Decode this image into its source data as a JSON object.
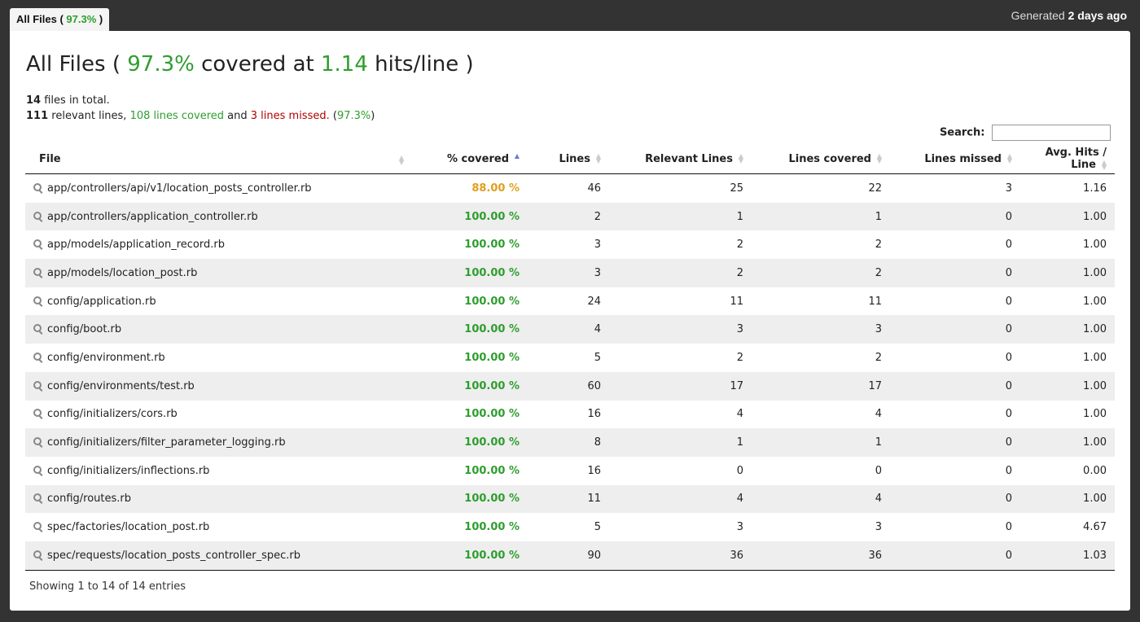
{
  "tab": {
    "label": "All Files (",
    "percent": "97.3%",
    "close": ")"
  },
  "generated": {
    "prefix": "Generated",
    "when": "2 days ago"
  },
  "heading": {
    "prefix": "All Files (",
    "percent": "97.3%",
    "middle": "covered at",
    "hits": "1.14",
    "suffix": "hits/line )"
  },
  "summary": {
    "files_count": "14",
    "files_text": "files in total.",
    "relevant": "111",
    "relevant_text": "relevant lines,",
    "covered_text": "108 lines covered",
    "and_text": "and",
    "missed_text": "3 lines missed.",
    "pct_open": "(",
    "pct": "97.3%",
    "pct_close": ")"
  },
  "search": {
    "label": "Search:",
    "value": ""
  },
  "table": {
    "headers": [
      "File",
      "% covered",
      "Lines",
      "Relevant Lines",
      "Lines covered",
      "Lines missed",
      "Avg. Hits / Line"
    ],
    "rows": [
      {
        "file": "app/controllers/api/v1/location_posts_controller.rb",
        "pct": "88.00 %",
        "lines": "46",
        "relevant": "25",
        "covered": "22",
        "missed": "3",
        "avg": "1.16"
      },
      {
        "file": "app/controllers/application_controller.rb",
        "pct": "100.00 %",
        "lines": "2",
        "relevant": "1",
        "covered": "1",
        "missed": "0",
        "avg": "1.00"
      },
      {
        "file": "app/models/application_record.rb",
        "pct": "100.00 %",
        "lines": "3",
        "relevant": "2",
        "covered": "2",
        "missed": "0",
        "avg": "1.00"
      },
      {
        "file": "app/models/location_post.rb",
        "pct": "100.00 %",
        "lines": "3",
        "relevant": "2",
        "covered": "2",
        "missed": "0",
        "avg": "1.00"
      },
      {
        "file": "config/application.rb",
        "pct": "100.00 %",
        "lines": "24",
        "relevant": "11",
        "covered": "11",
        "missed": "0",
        "avg": "1.00"
      },
      {
        "file": "config/boot.rb",
        "pct": "100.00 %",
        "lines": "4",
        "relevant": "3",
        "covered": "3",
        "missed": "0",
        "avg": "1.00"
      },
      {
        "file": "config/environment.rb",
        "pct": "100.00 %",
        "lines": "5",
        "relevant": "2",
        "covered": "2",
        "missed": "0",
        "avg": "1.00"
      },
      {
        "file": "config/environments/test.rb",
        "pct": "100.00 %",
        "lines": "60",
        "relevant": "17",
        "covered": "17",
        "missed": "0",
        "avg": "1.00"
      },
      {
        "file": "config/initializers/cors.rb",
        "pct": "100.00 %",
        "lines": "16",
        "relevant": "4",
        "covered": "4",
        "missed": "0",
        "avg": "1.00"
      },
      {
        "file": "config/initializers/filter_parameter_logging.rb",
        "pct": "100.00 %",
        "lines": "8",
        "relevant": "1",
        "covered": "1",
        "missed": "0",
        "avg": "1.00"
      },
      {
        "file": "config/initializers/inflections.rb",
        "pct": "100.00 %",
        "lines": "16",
        "relevant": "0",
        "covered": "0",
        "missed": "0",
        "avg": "0.00"
      },
      {
        "file": "config/routes.rb",
        "pct": "100.00 %",
        "lines": "11",
        "relevant": "4",
        "covered": "4",
        "missed": "0",
        "avg": "1.00"
      },
      {
        "file": "spec/factories/location_post.rb",
        "pct": "100.00 %",
        "lines": "5",
        "relevant": "3",
        "covered": "3",
        "missed": "0",
        "avg": "4.67"
      },
      {
        "file": "spec/requests/location_posts_controller_spec.rb",
        "pct": "100.00 %",
        "lines": "90",
        "relevant": "36",
        "covered": "36",
        "missed": "0",
        "avg": "1.03"
      }
    ]
  },
  "footer": "Showing 1 to 14 of 14 entries",
  "colors": {
    "green": "#2e9e2e",
    "orange": "#e0a020",
    "red": "#b30000",
    "sort_active": "#6a79d8"
  },
  "icons": {
    "row_icon": "magnifier-icon",
    "sort_icon": "sort-arrows-icon"
  }
}
